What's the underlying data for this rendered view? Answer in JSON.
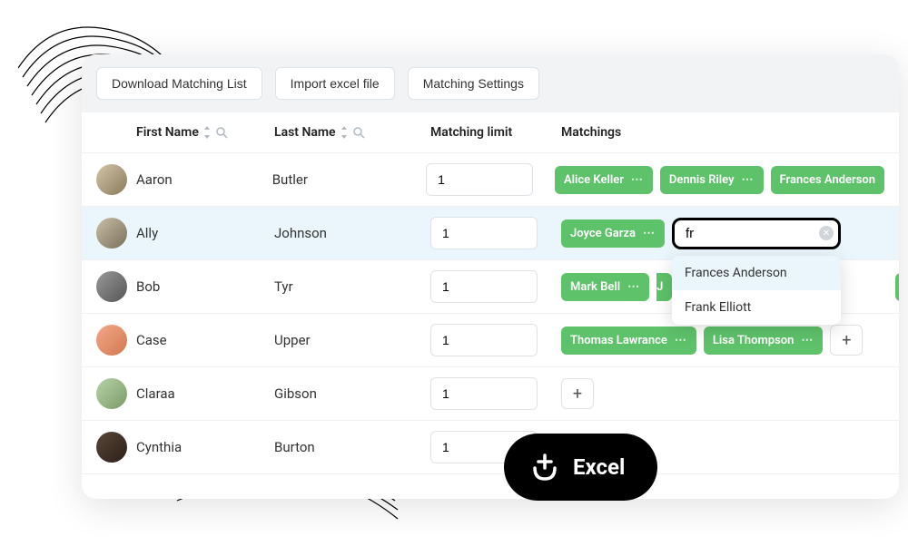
{
  "toolbar": {
    "download_label": "Download Matching List",
    "import_label": "Import excel file",
    "settings_label": "Matching Settings"
  },
  "columns": {
    "first_name": "First Name",
    "last_name": "Last Name",
    "matching_limit": "Matching limit",
    "matchings": "Matchings"
  },
  "search": {
    "value": "fr",
    "suggestions": [
      "Frances Anderson",
      "Frank Elliott"
    ]
  },
  "rows": [
    {
      "first_name": "Aaron",
      "last_name": "Butler",
      "limit": "1",
      "matchings": [
        "Alice Keller",
        "Dennis Riley",
        "Frances Anderson"
      ]
    },
    {
      "first_name": "Ally",
      "last_name": "Johnson",
      "limit": "1",
      "matchings": [
        "Joyce Garza"
      ]
    },
    {
      "first_name": "Bob",
      "last_name": "Tyr",
      "limit": "1",
      "matchings": [
        "Mark Bell",
        "J"
      ]
    },
    {
      "first_name": "Case",
      "last_name": "Upper",
      "limit": "1",
      "matchings": [
        "Thomas Lawrance",
        "Lisa Thompson"
      ]
    },
    {
      "first_name": "Claraa",
      "last_name": "Gibson",
      "limit": "1",
      "matchings": []
    },
    {
      "first_name": "Cynthia",
      "last_name": "Burton",
      "limit": "1",
      "matchings": []
    }
  ],
  "badge": {
    "label": "Excel"
  }
}
